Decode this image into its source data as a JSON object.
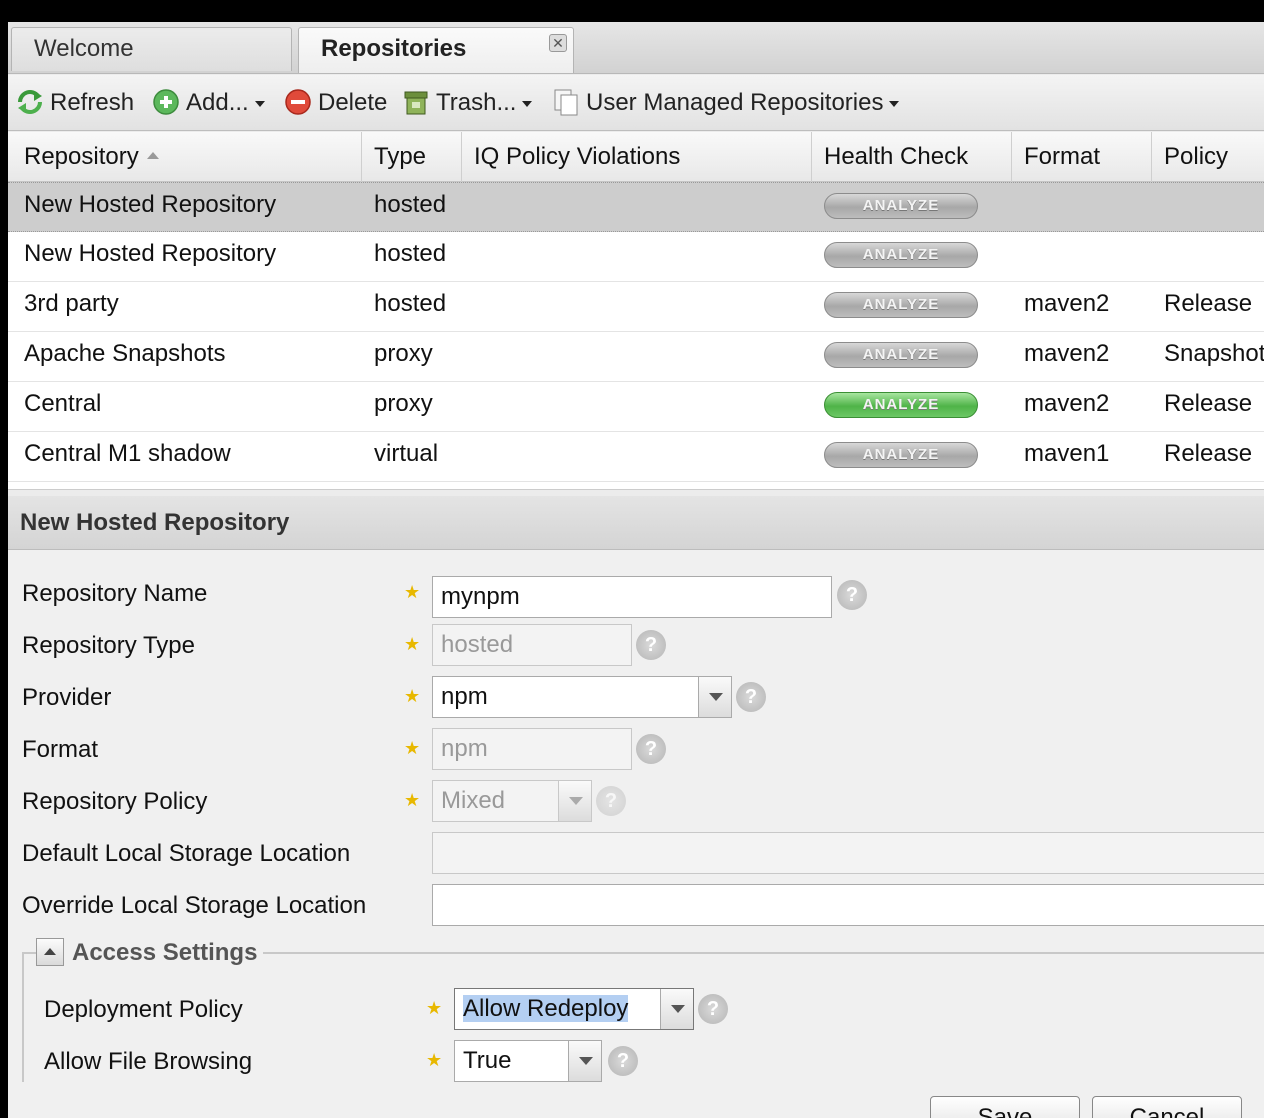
{
  "tabs": [
    {
      "label": "Welcome",
      "active": false
    },
    {
      "label": "Repositories",
      "active": true,
      "close": "✕"
    }
  ],
  "toolbar": {
    "refresh": "Refresh",
    "add": "Add...",
    "delete": "Delete",
    "trash": "Trash...",
    "user_managed": "User Managed Repositories"
  },
  "grid": {
    "columns": [
      "Repository",
      "Type",
      "IQ Policy Violations",
      "Health Check",
      "Format",
      "Policy"
    ],
    "analyze_label": "ANALYZE",
    "rows": [
      {
        "repository": "New Hosted Repository",
        "type": "hosted",
        "format": "",
        "policy": "",
        "health": "gray",
        "selected": true
      },
      {
        "repository": "New Hosted Repository",
        "type": "hosted",
        "format": "",
        "policy": "",
        "health": "gray",
        "selected": false
      },
      {
        "repository": "3rd party",
        "type": "hosted",
        "format": "maven2",
        "policy": "Release",
        "health": "gray",
        "selected": false
      },
      {
        "repository": "Apache Snapshots",
        "type": "proxy",
        "format": "maven2",
        "policy": "Snapshot",
        "health": "gray",
        "selected": false
      },
      {
        "repository": "Central",
        "type": "proxy",
        "format": "maven2",
        "policy": "Release",
        "health": "green",
        "selected": false
      },
      {
        "repository": "Central M1 shadow",
        "type": "virtual",
        "format": "maven1",
        "policy": "Release",
        "health": "gray",
        "selected": false
      }
    ]
  },
  "form": {
    "title": "New Hosted Repository",
    "repository_name_label": "Repository Name",
    "repository_name_value": "mynpm",
    "repository_type_label": "Repository Type",
    "repository_type_value": "hosted",
    "provider_label": "Provider",
    "provider_value": "npm",
    "format_label": "Format",
    "format_value": "npm",
    "repository_policy_label": "Repository Policy",
    "repository_policy_value": "Mixed",
    "default_storage_label": "Default Local Storage Location",
    "default_storage_value": "",
    "override_storage_label": "Override Local Storage Location",
    "override_storage_value": "",
    "access_settings_label": "Access Settings",
    "deployment_policy_label": "Deployment Policy",
    "deployment_policy_value": "Allow Redeploy",
    "file_browsing_label": "Allow File Browsing",
    "file_browsing_value": "True",
    "save_label": "Save",
    "cancel_label": "Cancel",
    "required_mark": "★",
    "help_mark": "?"
  },
  "colors": {
    "health_green": "#4fb348",
    "health_gray": "#a8a8a8",
    "required_star": "#e8b800",
    "selection": "#b4cff2"
  }
}
